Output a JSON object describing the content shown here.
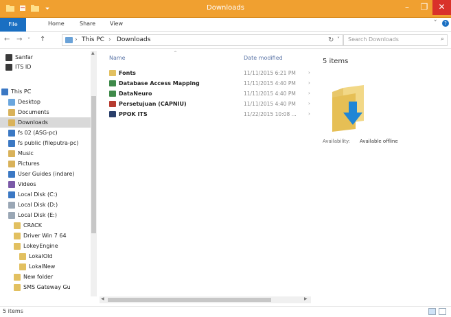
{
  "window": {
    "title": "Downloads"
  },
  "controls": {
    "minimize": "–",
    "maximize": "❐",
    "close": "✕"
  },
  "quick_access_icons": [
    "folder-icon",
    "properties-icon",
    "new-folder-icon",
    "dropdown-icon"
  ],
  "ribbon": {
    "file": "File",
    "tabs": [
      "Home",
      "Share",
      "View"
    ],
    "expand": "˅",
    "help": "?"
  },
  "nav": {
    "back": "←",
    "forward": "→",
    "recent": "˅",
    "up": "↑"
  },
  "address": {
    "sep": "›",
    "crumbs": [
      "This PC",
      "Downloads"
    ],
    "dropdown": "˅"
  },
  "refresh": "↻",
  "search": {
    "placeholder": "Search Downloads",
    "icon": "⌕"
  },
  "sidebar": [
    {
      "label": "Sanfar",
      "color": "#3a3a3a"
    },
    {
      "label": "ITS ID",
      "color": "#3a3a3a"
    },
    {
      "label": "This PC",
      "color": "#3b78c4"
    },
    {
      "label": "Desktop",
      "color": "#6aa6de"
    },
    {
      "label": "Documents",
      "color": "#d9b25a"
    },
    {
      "label": "Downloads",
      "color": "#d9b25a",
      "selected": true
    },
    {
      "label": "fs 02 (ASG-pc)",
      "color": "#3b78c4"
    },
    {
      "label": "fs public (fileputra-pc)",
      "color": "#3b78c4"
    },
    {
      "label": "Music",
      "color": "#d9b25a"
    },
    {
      "label": "Pictures",
      "color": "#d9b25a"
    },
    {
      "label": "User Guides (indare)",
      "color": "#3b78c4"
    },
    {
      "label": "Videos",
      "color": "#7b5aa8"
    },
    {
      "label": "Local Disk (C:)",
      "color": "#3b78c4"
    },
    {
      "label": "Local Disk (D:)",
      "color": "#9aa7b5"
    },
    {
      "label": "Local Disk (E:)",
      "color": "#9aa7b5"
    },
    {
      "label": "CRACK",
      "color": "#e2c060"
    },
    {
      "label": "Driver Win 7 64",
      "color": "#e2c060"
    },
    {
      "label": "LokeyEngine",
      "color": "#e2c060"
    },
    {
      "label": "LokalOld",
      "color": "#e2c060"
    },
    {
      "label": "LokalNew",
      "color": "#e2c060"
    },
    {
      "label": "New folder",
      "color": "#e2c060"
    },
    {
      "label": "SMS Gateway Gu",
      "color": "#e2c060"
    }
  ],
  "columns": {
    "name": "Name",
    "date": "Date modified",
    "sort": "^"
  },
  "files": [
    {
      "name": "Fonts",
      "date": "11/11/2015 6:21 PM",
      "color": "#e2c060"
    },
    {
      "name": "Database Access Mapping",
      "date": "11/11/2015 4:40 PM",
      "color": "#3f8a4a"
    },
    {
      "name": "DataNeuro",
      "date": "11/11/2015 4:40 PM",
      "color": "#3f8a4a"
    },
    {
      "name": "Persetujuan (CAPNIU)",
      "date": "11/11/2015 4:40 PM",
      "color": "#b63b30"
    },
    {
      "name": "PPOK ITS",
      "date": "11/22/2015 10:08 ...",
      "color": "#2a3f6a"
    }
  ],
  "detail": {
    "count": "5 items",
    "availability_label": "Availability:",
    "availability_value": "Available offline"
  },
  "status": {
    "text": "5 items"
  }
}
